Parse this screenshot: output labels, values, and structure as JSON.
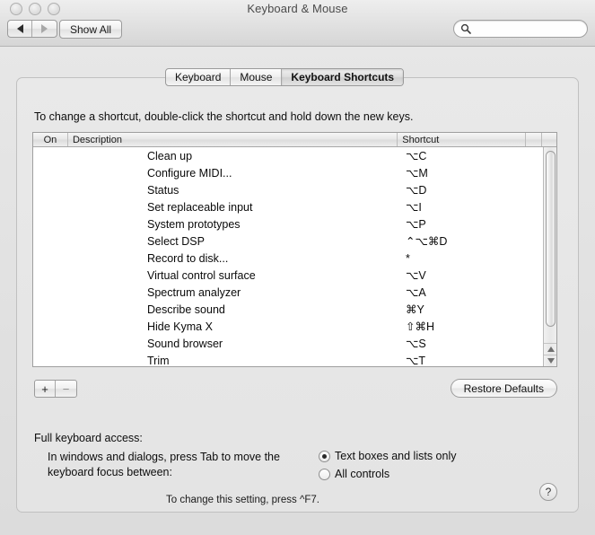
{
  "window": {
    "title": "Keyboard & Mouse",
    "traffic_lights": [
      "close",
      "minimize",
      "zoom"
    ]
  },
  "toolbar": {
    "back_label": "◀",
    "forward_label": "▶",
    "show_all_label": "Show All",
    "search": {
      "value": "",
      "placeholder": "",
      "icon": "search-icon"
    }
  },
  "tabs": [
    {
      "label": "Keyboard",
      "selected": false
    },
    {
      "label": "Mouse",
      "selected": false
    },
    {
      "label": "Keyboard Shortcuts",
      "selected": true
    }
  ],
  "instructions": "To change a shortcut, double-click the shortcut and hold down the new keys.",
  "table": {
    "columns": [
      {
        "label": "On",
        "key": "on"
      },
      {
        "label": "Description",
        "key": "description"
      },
      {
        "label": "Shortcut",
        "key": "shortcut"
      },
      {
        "label": "",
        "key": "extra1"
      },
      {
        "label": "",
        "key": "extra2"
      }
    ],
    "rows": [
      {
        "on": "",
        "description": "Clean up",
        "shortcut": "⌥C"
      },
      {
        "on": "",
        "description": "Configure MIDI...",
        "shortcut": "⌥M"
      },
      {
        "on": "",
        "description": "Status",
        "shortcut": "⌥D"
      },
      {
        "on": "",
        "description": "Set replaceable input",
        "shortcut": "⌥I"
      },
      {
        "on": "",
        "description": "System prototypes",
        "shortcut": "⌥P"
      },
      {
        "on": "",
        "description": "Select DSP",
        "shortcut": "⌃⌥⌘D"
      },
      {
        "on": "",
        "description": "Record to disk...",
        "shortcut": "*"
      },
      {
        "on": "",
        "description": "Virtual control surface",
        "shortcut": "⌥V"
      },
      {
        "on": "",
        "description": "Spectrum analyzer",
        "shortcut": "⌥A"
      },
      {
        "on": "",
        "description": "Describe sound",
        "shortcut": "⌘Y"
      },
      {
        "on": "",
        "description": "Hide Kyma X",
        "shortcut": "⇧⌘H"
      },
      {
        "on": "",
        "description": "Sound browser",
        "shortcut": "⌥S"
      },
      {
        "on": "",
        "description": "Trim",
        "shortcut": "⌥T"
      }
    ],
    "scrollbar": {
      "up_arrow": "▲",
      "down_arrow": "▼"
    }
  },
  "buttons": {
    "add_label": "+",
    "remove_label": "−",
    "restore_defaults_label": "Restore Defaults"
  },
  "full_keyboard_access": {
    "title": "Full keyboard access:",
    "description": "In windows and dialogs, press Tab to move the keyboard focus between:",
    "options": [
      {
        "label": "Text boxes and lists only",
        "selected": true
      },
      {
        "label": "All controls",
        "selected": false
      }
    ],
    "hint": "To change this setting, press ^F7."
  },
  "help": {
    "label": "?"
  },
  "colors": {
    "window_bg": "#e4e4e4",
    "titlebar_top": "#eeeeee",
    "table_bg": "#ffffff",
    "text": "#0d0d0d"
  }
}
